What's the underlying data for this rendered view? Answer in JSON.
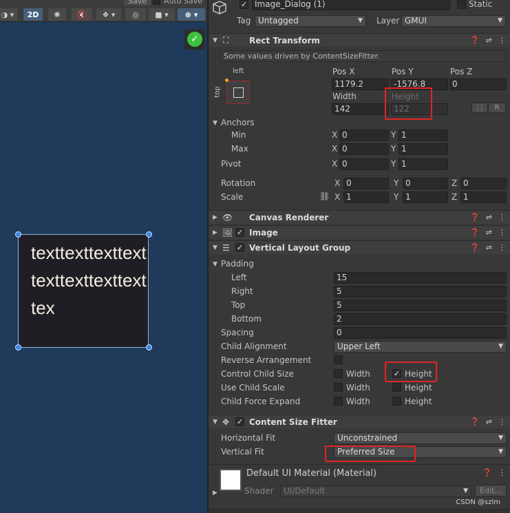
{
  "scene": {
    "top_save_label": "Save",
    "top_autosave_label": "Auto Save",
    "toolbar_2d_label": "2D",
    "dialog_text": "texttexttexttexttexttexttexttexttex"
  },
  "inspector": {
    "object_name": "Image_Dialog (1)",
    "static_label": "Static",
    "tag_label": "Tag",
    "tag_value": "Untagged",
    "layer_label": "Layer",
    "layer_value": "GMUI"
  },
  "rect_transform": {
    "title": "Rect Transform",
    "note": "Some values driven by ContentSizeFitter.",
    "anchor_preset_left": "left",
    "anchor_preset_top": "top",
    "posx_label": "Pos X",
    "posx_value": "1179.2",
    "posy_label": "Pos Y",
    "posy_value": "-1576.8",
    "posz_label": "Pos Z",
    "posz_value": "0",
    "width_label": "Width",
    "width_value": "142",
    "height_label": "Height",
    "height_value": "122",
    "blueprint_btn": "⬚",
    "raw_btn": "R",
    "anchors_label": "Anchors",
    "min_label": "Min",
    "min_x": "0",
    "min_y": "1",
    "max_label": "Max",
    "max_x": "0",
    "max_y": "1",
    "pivot_label": "Pivot",
    "pivot_x": "0",
    "pivot_y": "1",
    "rotation_label": "Rotation",
    "rot_x": "0",
    "rot_y": "0",
    "rot_z": "0",
    "scale_label": "Scale",
    "scale_x": "1",
    "scale_y": "1",
    "scale_z": "1",
    "x": "X",
    "y": "Y",
    "z": "Z"
  },
  "canvas_renderer": {
    "title": "Canvas Renderer"
  },
  "image": {
    "title": "Image"
  },
  "vlg": {
    "title": "Vertical Layout Group",
    "padding_label": "Padding",
    "left_label": "Left",
    "left_value": "15",
    "right_label": "Right",
    "right_value": "5",
    "top_label": "Top",
    "top_value": "5",
    "bottom_label": "Bottom",
    "bottom_value": "2",
    "spacing_label": "Spacing",
    "spacing_value": "0",
    "child_alignment_label": "Child Alignment",
    "child_alignment_value": "Upper Left",
    "reverse_label": "Reverse Arrangement",
    "control_label": "Control Child Size",
    "use_scale_label": "Use Child Scale",
    "force_expand_label": "Child Force Expand",
    "width_label": "Width",
    "height_label": "Height"
  },
  "csf": {
    "title": "Content Size Fitter",
    "hfit_label": "Horizontal Fit",
    "hfit_value": "Unconstrained",
    "vfit_label": "Vertical Fit",
    "vfit_value": "Preferred Size"
  },
  "material": {
    "name": "Default UI Material (Material)",
    "shader_label": "Shader",
    "shader_value": "UI/Default",
    "edit_label": "Edit..."
  },
  "watermark": "CSDN @szlm"
}
